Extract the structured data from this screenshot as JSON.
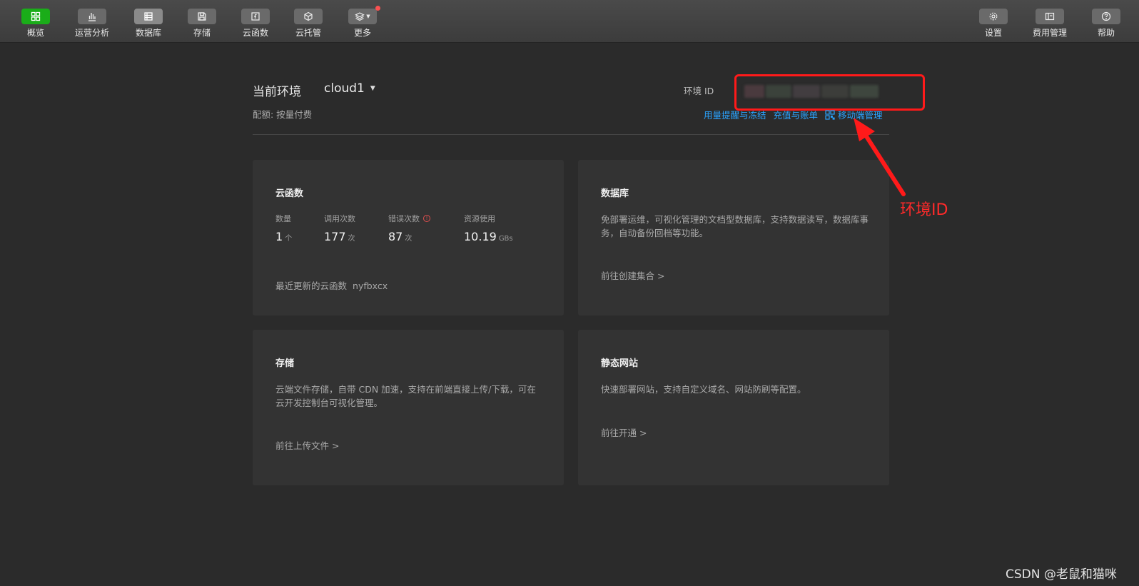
{
  "toolbar": {
    "left": [
      {
        "label": "概览",
        "icon": "grid-icon",
        "state": "active"
      },
      {
        "label": "运营分析",
        "icon": "bar-chart-icon",
        "state": "normal"
      },
      {
        "label": "数据库",
        "icon": "database-icon",
        "state": "selected"
      },
      {
        "label": "存储",
        "icon": "floppy-icon",
        "state": "normal"
      },
      {
        "label": "云函数",
        "icon": "function-icon",
        "state": "normal"
      },
      {
        "label": "云托管",
        "icon": "cube-icon",
        "state": "normal"
      },
      {
        "label": "更多",
        "icon": "layers-icon",
        "state": "badge"
      }
    ],
    "right": [
      {
        "label": "设置",
        "icon": "gear-icon"
      },
      {
        "label": "费用管理",
        "icon": "wallet-icon"
      },
      {
        "label": "帮助",
        "icon": "help-icon"
      }
    ]
  },
  "header": {
    "env_title": "当前环境",
    "env_name": "cloud1",
    "quota": "配额: 按量付费",
    "env_id_label": "环境 ID",
    "links": {
      "usage": "用量提醒与冻结",
      "recharge": "充值与账单",
      "mobile": "移动端管理"
    }
  },
  "cards": {
    "functions": {
      "title": "云函数",
      "stats": [
        {
          "label": "数量",
          "value": "1",
          "unit": "个"
        },
        {
          "label": "调用次数",
          "value": "177",
          "unit": "次"
        },
        {
          "label": "错误次数",
          "value": "87",
          "unit": "次"
        },
        {
          "label": "资源使用",
          "value": "10.19",
          "unit": "GBs"
        }
      ],
      "recent_label": "最近更新的云函数",
      "recent_name": "nyfbxcx"
    },
    "database": {
      "title": "数据库",
      "desc": "免部署运维，可视化管理的文档型数据库，支持数据读写，数据库事务，自动备份回档等功能。",
      "link": "前往创建集合 >"
    },
    "storage": {
      "title": "存储",
      "desc": "云端文件存储，自带 CDN 加速，支持在前端直接上传/下载，可在云开发控制台可视化管理。",
      "link": "前往上传文件 >"
    },
    "hosting": {
      "title": "静态网站",
      "desc": "快速部署网站，支持自定义域名、网站防刷等配置。",
      "link": "前往开通 >"
    }
  },
  "annotation": {
    "label": "环境ID",
    "color": "#ff2a2a"
  },
  "watermark": "CSDN @老鼠和猫咪",
  "colors": {
    "accent": "#1aad19",
    "link": "#2aa3ff",
    "badge": "#fa5151"
  }
}
